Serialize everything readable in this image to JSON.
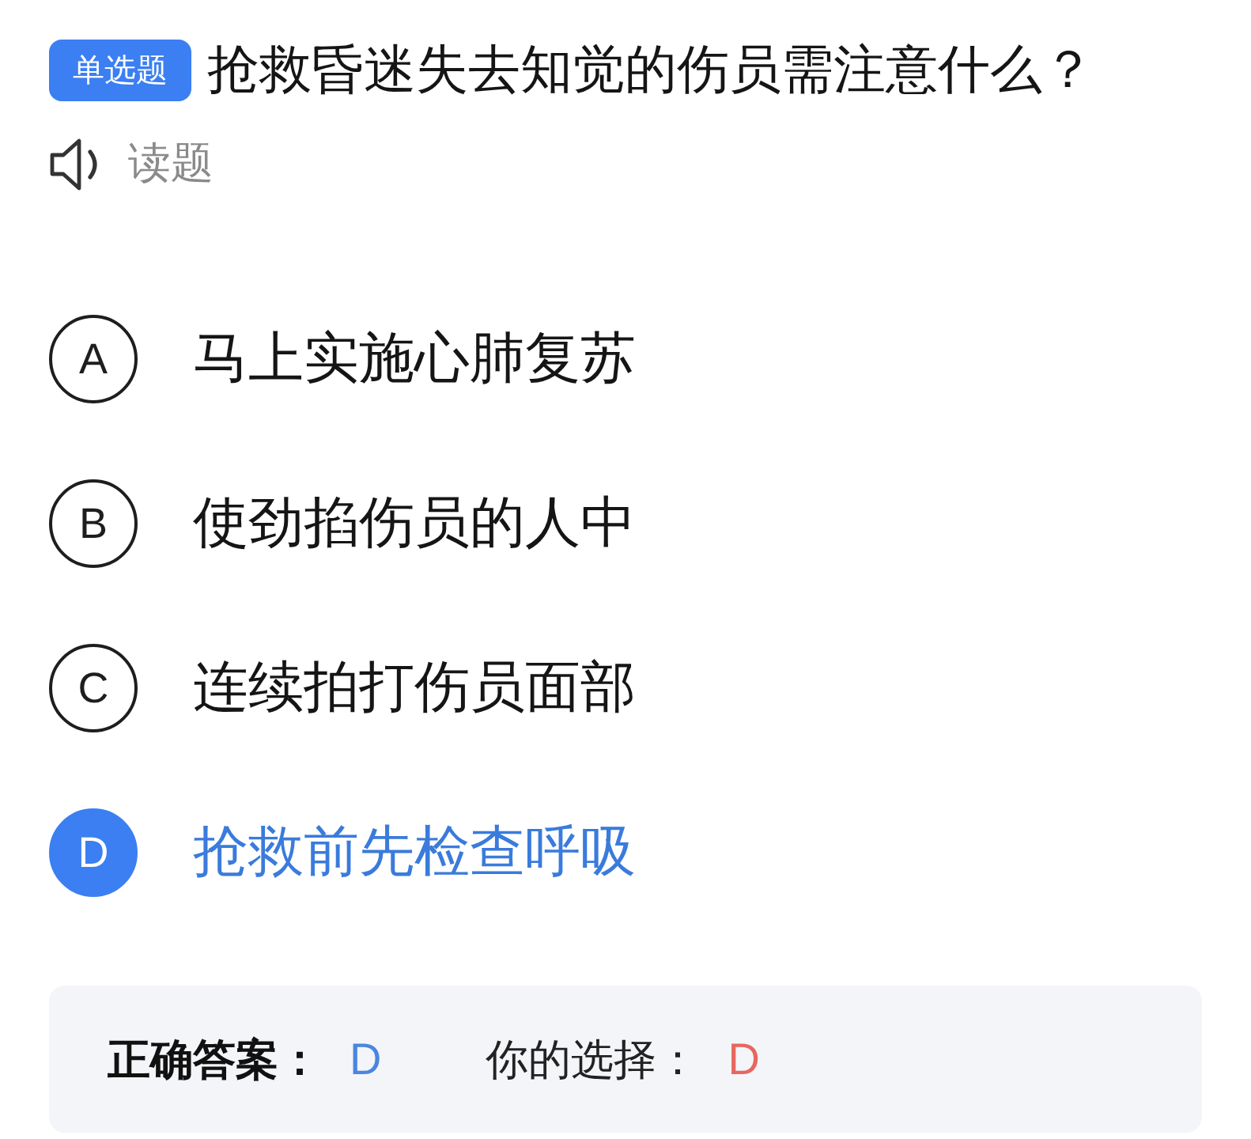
{
  "question": {
    "type_badge": "单选题",
    "text": "抢救昏迷失去知觉的伤员需注意什么？",
    "read_aloud": "读题"
  },
  "options": [
    {
      "letter": "A",
      "text": "马上实施心肺复苏",
      "selected": false
    },
    {
      "letter": "B",
      "text": "使劲掐伤员的人中",
      "selected": false
    },
    {
      "letter": "C",
      "text": "连续拍打伤员面部",
      "selected": false
    },
    {
      "letter": "D",
      "text": "抢救前先检查呼吸",
      "selected": true
    }
  ],
  "result": {
    "correct_label": "正确答案：",
    "correct_value": "D",
    "choice_label": "你的选择：",
    "choice_value": "D"
  }
}
